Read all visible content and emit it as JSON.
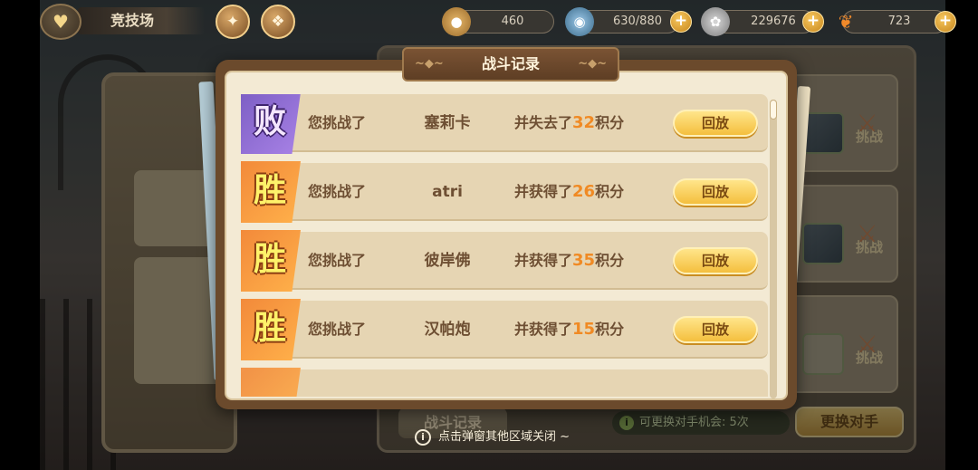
{
  "topbar": {
    "back_icon": "heart-back-icon",
    "title": "竞技场",
    "resources": [
      {
        "name": "coin",
        "value": "460"
      },
      {
        "name": "stamina",
        "value": "630/880"
      },
      {
        "name": "gems",
        "value": "229676"
      },
      {
        "name": "carrot",
        "value": "723"
      }
    ],
    "plus_label": "+"
  },
  "modal": {
    "title": "战斗记录",
    "records": [
      {
        "result_label": "败",
        "result": "lose",
        "prefix": "您挑战了",
        "opponent": "塞莉卡",
        "outcome_text": "并失去了",
        "points": "32",
        "suffix": "积分",
        "replay_label": "回放"
      },
      {
        "result_label": "胜",
        "result": "win",
        "prefix": "您挑战了",
        "opponent": "atri",
        "outcome_text": "并获得了",
        "points": "26",
        "suffix": "积分",
        "replay_label": "回放"
      },
      {
        "result_label": "胜",
        "result": "win",
        "prefix": "您挑战了",
        "opponent": "彼岸佛",
        "outcome_text": "并获得了",
        "points": "35",
        "suffix": "积分",
        "replay_label": "回放"
      },
      {
        "result_label": "胜",
        "result": "win",
        "prefix": "您挑战了",
        "opponent": "汉帕炮",
        "outcome_text": "并获得了",
        "points": "15",
        "suffix": "积分",
        "replay_label": "回放"
      }
    ]
  },
  "background": {
    "opponent_challenge_label": "挑战",
    "battle_record_tab": "战斗记录",
    "swap_chances": "可更换对手机会: 5次",
    "swap_button": "更换对手",
    "close_hint": "点击弹窗其他区域关闭 ~"
  },
  "colors": {
    "win_badge": "#f2893a",
    "lose_badge": "#7c5ec4",
    "points_highlight": "#f08a24",
    "replay_button": "#f4bf3e"
  }
}
